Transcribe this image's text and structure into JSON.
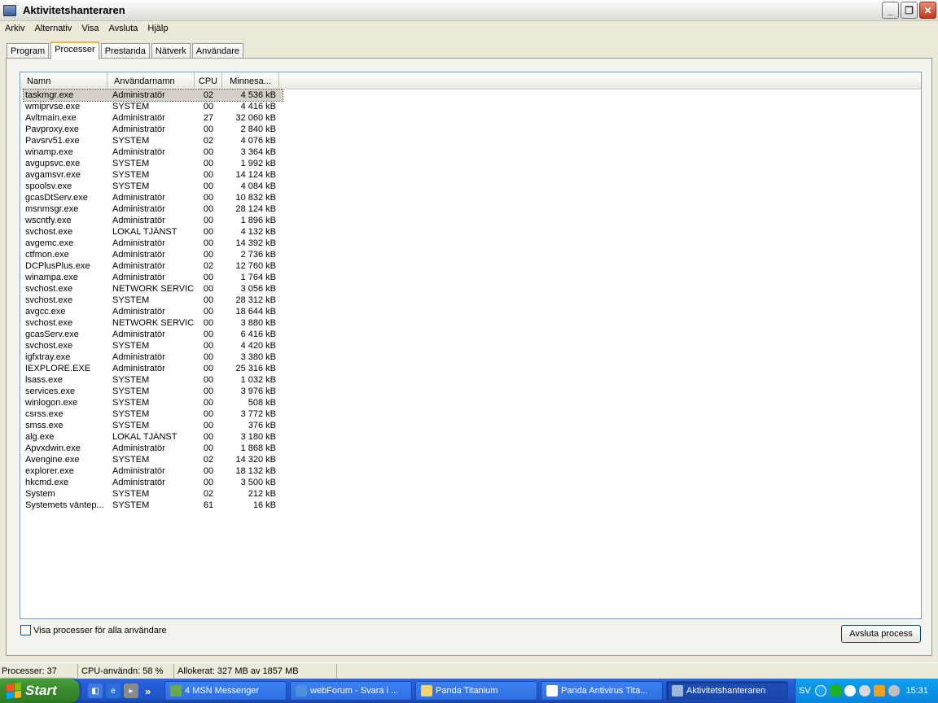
{
  "window": {
    "title": "Aktivitetshanteraren"
  },
  "menu": [
    "Arkiv",
    "Alternativ",
    "Visa",
    "Avsluta",
    "Hjälp"
  ],
  "tabs": [
    {
      "label": "Program",
      "active": false
    },
    {
      "label": "Processer",
      "active": true
    },
    {
      "label": "Prestanda",
      "active": false
    },
    {
      "label": "Nätverk",
      "active": false
    },
    {
      "label": "Användare",
      "active": false
    }
  ],
  "columns": {
    "name": "Namn",
    "user": "Användarnamn",
    "cpu": "CPU",
    "mem": "Minnesa..."
  },
  "processes": [
    {
      "name": "taskmgr.exe",
      "user": "Administratör",
      "cpu": "02",
      "mem": "4 536 kB",
      "selected": true
    },
    {
      "name": "wmiprvse.exe",
      "user": "SYSTEM",
      "cpu": "00",
      "mem": "4 416 kB"
    },
    {
      "name": "Avltmain.exe",
      "user": "Administratör",
      "cpu": "27",
      "mem": "32 060 kB"
    },
    {
      "name": "Pavproxy.exe",
      "user": "Administratör",
      "cpu": "00",
      "mem": "2 840 kB"
    },
    {
      "name": "Pavsrv51.exe",
      "user": "SYSTEM",
      "cpu": "02",
      "mem": "4 076 kB"
    },
    {
      "name": "winamp.exe",
      "user": "Administratör",
      "cpu": "00",
      "mem": "3 364 kB"
    },
    {
      "name": "avgupsvc.exe",
      "user": "SYSTEM",
      "cpu": "00",
      "mem": "1 992 kB"
    },
    {
      "name": "avgamsvr.exe",
      "user": "SYSTEM",
      "cpu": "00",
      "mem": "14 124 kB"
    },
    {
      "name": "spoolsv.exe",
      "user": "SYSTEM",
      "cpu": "00",
      "mem": "4 084 kB"
    },
    {
      "name": "gcasDtServ.exe",
      "user": "Administratör",
      "cpu": "00",
      "mem": "10 832 kB"
    },
    {
      "name": "msnmsgr.exe",
      "user": "Administratör",
      "cpu": "00",
      "mem": "28 124 kB"
    },
    {
      "name": "wscntfy.exe",
      "user": "Administratör",
      "cpu": "00",
      "mem": "1 896 kB"
    },
    {
      "name": "svchost.exe",
      "user": "LOKAL TJÄNST",
      "cpu": "00",
      "mem": "4 132 kB"
    },
    {
      "name": "avgemc.exe",
      "user": "Administratör",
      "cpu": "00",
      "mem": "14 392 kB"
    },
    {
      "name": "ctfmon.exe",
      "user": "Administratör",
      "cpu": "00",
      "mem": "2 736 kB"
    },
    {
      "name": "DCPlusPlus.exe",
      "user": "Administratör",
      "cpu": "02",
      "mem": "12 760 kB"
    },
    {
      "name": "winampa.exe",
      "user": "Administratör",
      "cpu": "00",
      "mem": "1 764 kB"
    },
    {
      "name": "svchost.exe",
      "user": "NETWORK SERVICE",
      "cpu": "00",
      "mem": "3 056 kB"
    },
    {
      "name": "svchost.exe",
      "user": "SYSTEM",
      "cpu": "00",
      "mem": "28 312 kB"
    },
    {
      "name": "avgcc.exe",
      "user": "Administratör",
      "cpu": "00",
      "mem": "18 644 kB"
    },
    {
      "name": "svchost.exe",
      "user": "NETWORK SERVICE",
      "cpu": "00",
      "mem": "3 880 kB"
    },
    {
      "name": "gcasServ.exe",
      "user": "Administratör",
      "cpu": "00",
      "mem": "6 416 kB"
    },
    {
      "name": "svchost.exe",
      "user": "SYSTEM",
      "cpu": "00",
      "mem": "4 420 kB"
    },
    {
      "name": "igfxtray.exe",
      "user": "Administratör",
      "cpu": "00",
      "mem": "3 380 kB"
    },
    {
      "name": "IEXPLORE.EXE",
      "user": "Administratör",
      "cpu": "00",
      "mem": "25 316 kB"
    },
    {
      "name": "lsass.exe",
      "user": "SYSTEM",
      "cpu": "00",
      "mem": "1 032 kB"
    },
    {
      "name": "services.exe",
      "user": "SYSTEM",
      "cpu": "00",
      "mem": "3 976 kB"
    },
    {
      "name": "winlogon.exe",
      "user": "SYSTEM",
      "cpu": "00",
      "mem": "508 kB"
    },
    {
      "name": "csrss.exe",
      "user": "SYSTEM",
      "cpu": "00",
      "mem": "3 772 kB"
    },
    {
      "name": "smss.exe",
      "user": "SYSTEM",
      "cpu": "00",
      "mem": "376 kB"
    },
    {
      "name": "alg.exe",
      "user": "LOKAL TJÄNST",
      "cpu": "00",
      "mem": "3 180 kB"
    },
    {
      "name": "Apvxdwin.exe",
      "user": "Administratör",
      "cpu": "00",
      "mem": "1 868 kB"
    },
    {
      "name": "Avengine.exe",
      "user": "SYSTEM",
      "cpu": "02",
      "mem": "14 320 kB"
    },
    {
      "name": "explorer.exe",
      "user": "Administratör",
      "cpu": "00",
      "mem": "18 132 kB"
    },
    {
      "name": "hkcmd.exe",
      "user": "Administratör",
      "cpu": "00",
      "mem": "3 500 kB"
    },
    {
      "name": "System",
      "user": "SYSTEM",
      "cpu": "02",
      "mem": "212 kB"
    },
    {
      "name": "Systemets väntep...",
      "user": "SYSTEM",
      "cpu": "61",
      "mem": "16 kB"
    }
  ],
  "controls": {
    "show_all_label": "Visa processer för alla användare",
    "show_all_checked": false,
    "end_process_label": "Avsluta process"
  },
  "status": {
    "processes": "Processer: 37",
    "cpu": "CPU-användn: 58 %",
    "memory": "Allokerat: 327 MB av 1857 MB"
  },
  "taskbar": {
    "start_label": "Start",
    "buttons": [
      {
        "label": "4 MSN Messenger",
        "icon": "msn-icon",
        "color": "#6aa84f",
        "active": false
      },
      {
        "label": "webForum - Svara i ...",
        "icon": "ie-icon",
        "color": "#4f8fe0",
        "active": false
      },
      {
        "label": "Panda Titanium",
        "icon": "folder-icon",
        "color": "#f4d36b",
        "active": false
      },
      {
        "label": "Panda Antivirus Tita...",
        "icon": "panda-icon",
        "color": "#ffffff",
        "active": false
      },
      {
        "label": "Aktivitetshanteraren",
        "icon": "taskmgr-icon",
        "color": "#9fb6d8",
        "active": true
      }
    ],
    "language": "SV",
    "clock": "15:31"
  }
}
